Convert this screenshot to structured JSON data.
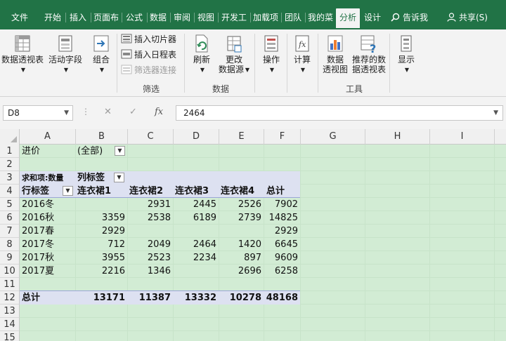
{
  "menu": {
    "tabs": [
      "文件",
      "开始",
      "插入",
      "页面布",
      "公式",
      "数据",
      "审阅",
      "视图",
      "开发工",
      "加载项",
      "团队",
      "我的菜",
      "分析",
      "设计"
    ],
    "active_tab": "分析",
    "tell_me": "告诉我",
    "share": "共享(S)"
  },
  "ribbon": {
    "pivot_table": "数据透视表",
    "active_field": "活动字段",
    "group": "组合",
    "insert_slicer": "插入切片器",
    "insert_timeline": "插入日程表",
    "filter_connections": "筛选器连接",
    "filter_group_label": "筛选",
    "refresh": "刷新",
    "change_source_1": "更改",
    "change_source_2": "数据源",
    "data_group_label": "数据",
    "actions": "操作",
    "calculations": "计算",
    "pivot_chart_1": "数据",
    "pivot_chart_2": "透视图",
    "recommended_1": "推荐的数",
    "recommended_2": "据透视表",
    "tools_group_label": "工具",
    "show": "显示"
  },
  "formula_bar": {
    "name_box": "D8",
    "cancel": "✕",
    "enter": "✓",
    "fx": "fx",
    "value": "2464"
  },
  "sheet": {
    "columns": [
      "A",
      "B",
      "C",
      "D",
      "E",
      "F",
      "G",
      "H",
      "I"
    ],
    "rows": [
      "1",
      "2",
      "3",
      "4",
      "5",
      "6",
      "7",
      "8",
      "9",
      "10",
      "11",
      "12",
      "13",
      "14",
      "15"
    ],
    "filter_label": "进价",
    "filter_value": "(全部)",
    "values_label": "求和项:数量",
    "col_labels": "列标签",
    "row_labels": "行标签",
    "headers": [
      "连衣裙1",
      "连衣裙2",
      "连衣裙3",
      "连衣裙4",
      "总计"
    ],
    "data_rows": [
      {
        "label": "2016冬",
        "values": [
          "",
          "2931",
          "2445",
          "2526",
          "7902"
        ]
      },
      {
        "label": "2016秋",
        "values": [
          "3359",
          "2538",
          "6189",
          "2739",
          "14825"
        ]
      },
      {
        "label": "2017春",
        "values": [
          "2929",
          "",
          "",
          "",
          "2929"
        ]
      },
      {
        "label": "2017冬",
        "values": [
          "712",
          "2049",
          "2464",
          "1420",
          "6645"
        ]
      },
      {
        "label": "2017秋",
        "values": [
          "3955",
          "2523",
          "2234",
          "897",
          "9609"
        ]
      },
      {
        "label": "2017夏",
        "values": [
          "2216",
          "1346",
          "",
          "2696",
          "6258"
        ]
      }
    ],
    "total_label": "总计",
    "totals": [
      "13171",
      "11387",
      "13332",
      "10278",
      "48168"
    ]
  }
}
